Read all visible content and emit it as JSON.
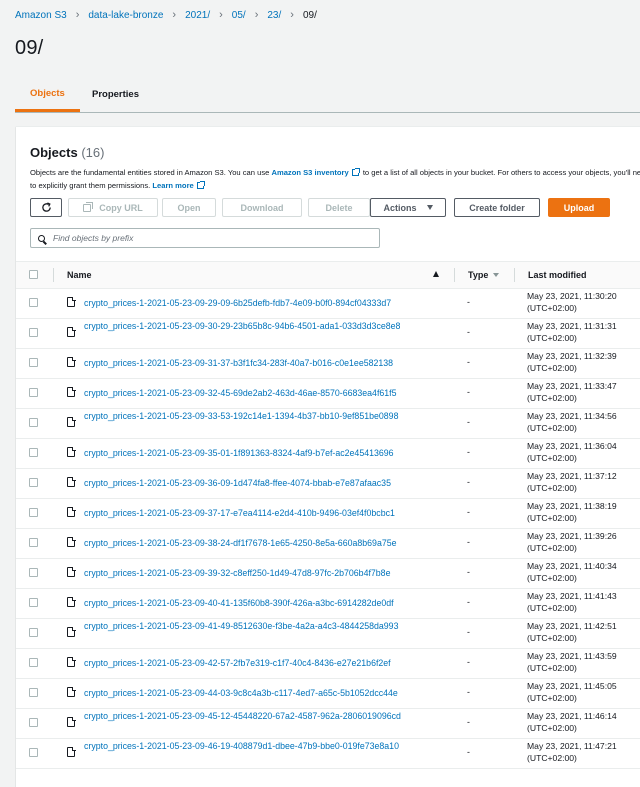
{
  "breadcrumb": [
    "Amazon S3",
    "data-lake-bronze",
    "2021/",
    "05/",
    "23/",
    "09/"
  ],
  "page_title": "09/",
  "tabs": [
    {
      "label": "Objects",
      "active": true
    },
    {
      "label": "Properties",
      "active": false
    }
  ],
  "panel": {
    "title": "Objects",
    "count": "(16)",
    "desc_part1": "Objects are the fundamental entities stored in Amazon S3. You can use ",
    "desc_link1": "Amazon S3 inventory",
    "desc_part2": " to get a list of all objects in your bucket. For others to access your objects, you'll need to explicitly grant them permissions. ",
    "desc_link2": "Learn more"
  },
  "toolbar": {
    "copy_url": "Copy URL",
    "open": "Open",
    "download": "Download",
    "delete": "Delete",
    "actions": "Actions",
    "create_folder": "Create folder",
    "upload": "Upload"
  },
  "search": {
    "placeholder": "Find objects by prefix"
  },
  "columns": {
    "name": "Name",
    "type": "Type",
    "modified": "Last modified"
  },
  "objects": [
    {
      "name": "crypto_prices-1-2021-05-23-09-29-09-6b25defb-fdb7-4e09-b0f0-894cf04333d7",
      "type": "-",
      "date": "May 23, 2021, 11:30:20",
      "tz": "(UTC+02:00)"
    },
    {
      "name": "crypto_prices-1-2021-05-23-09-30-29-23b65b8c-94b6-4501-ada1-033d3d3ce8e8",
      "type": "-",
      "date": "May 23, 2021, 11:31:31",
      "tz": "(UTC+02:00)"
    },
    {
      "name": "crypto_prices-1-2021-05-23-09-31-37-b3f1fc34-283f-40a7-b016-c0e1ee582138",
      "type": "-",
      "date": "May 23, 2021, 11:32:39",
      "tz": "(UTC+02:00)"
    },
    {
      "name": "crypto_prices-1-2021-05-23-09-32-45-69de2ab2-463d-46ae-8570-6683ea4f61f5",
      "type": "-",
      "date": "May 23, 2021, 11:33:47",
      "tz": "(UTC+02:00)"
    },
    {
      "name": "crypto_prices-1-2021-05-23-09-33-53-192c14e1-1394-4b37-bb10-9ef851be0898",
      "type": "-",
      "date": "May 23, 2021, 11:34:56",
      "tz": "(UTC+02:00)"
    },
    {
      "name": "crypto_prices-1-2021-05-23-09-35-01-1f891363-8324-4af9-b7ef-ac2e45413696",
      "type": "-",
      "date": "May 23, 2021, 11:36:04",
      "tz": "(UTC+02:00)"
    },
    {
      "name": "crypto_prices-1-2021-05-23-09-36-09-1d474fa8-ffee-4074-bbab-e7e87afaac35",
      "type": "-",
      "date": "May 23, 2021, 11:37:12",
      "tz": "(UTC+02:00)"
    },
    {
      "name": "crypto_prices-1-2021-05-23-09-37-17-e7ea4114-e2d4-410b-9496-03ef4f0bcbc1",
      "type": "-",
      "date": "May 23, 2021, 11:38:19",
      "tz": "(UTC+02:00)"
    },
    {
      "name": "crypto_prices-1-2021-05-23-09-38-24-df1f7678-1e65-4250-8e5a-660a8b69a75e",
      "type": "-",
      "date": "May 23, 2021, 11:39:26",
      "tz": "(UTC+02:00)"
    },
    {
      "name": "crypto_prices-1-2021-05-23-09-39-32-c8eff250-1d49-47d8-97fc-2b706b4f7b8e",
      "type": "-",
      "date": "May 23, 2021, 11:40:34",
      "tz": "(UTC+02:00)"
    },
    {
      "name": "crypto_prices-1-2021-05-23-09-40-41-135f60b8-390f-426a-a3bc-6914282de0df",
      "type": "-",
      "date": "May 23, 2021, 11:41:43",
      "tz": "(UTC+02:00)"
    },
    {
      "name": "crypto_prices-1-2021-05-23-09-41-49-8512630e-f3be-4a2a-a4c3-4844258da993",
      "type": "-",
      "date": "May 23, 2021, 11:42:51",
      "tz": "(UTC+02:00)"
    },
    {
      "name": "crypto_prices-1-2021-05-23-09-42-57-2fb7e319-c1f7-40c4-8436-e27e21b6f2ef",
      "type": "-",
      "date": "May 23, 2021, 11:43:59",
      "tz": "(UTC+02:00)"
    },
    {
      "name": "crypto_prices-1-2021-05-23-09-44-03-9c8c4a3b-c117-4ed7-a65c-5b1052dcc44e",
      "type": "-",
      "date": "May 23, 2021, 11:45:05",
      "tz": "(UTC+02:00)"
    },
    {
      "name": "crypto_prices-1-2021-05-23-09-45-12-45448220-67a2-4587-962a-2806019096cd",
      "type": "-",
      "date": "May 23, 2021, 11:46:14",
      "tz": "(UTC+02:00)"
    },
    {
      "name": "crypto_prices-1-2021-05-23-09-46-19-408879d1-dbee-47b9-bbe0-019fe73e8a10",
      "type": "-",
      "date": "May 23, 2021, 11:47:21",
      "tz": "(UTC+02:00)"
    }
  ]
}
